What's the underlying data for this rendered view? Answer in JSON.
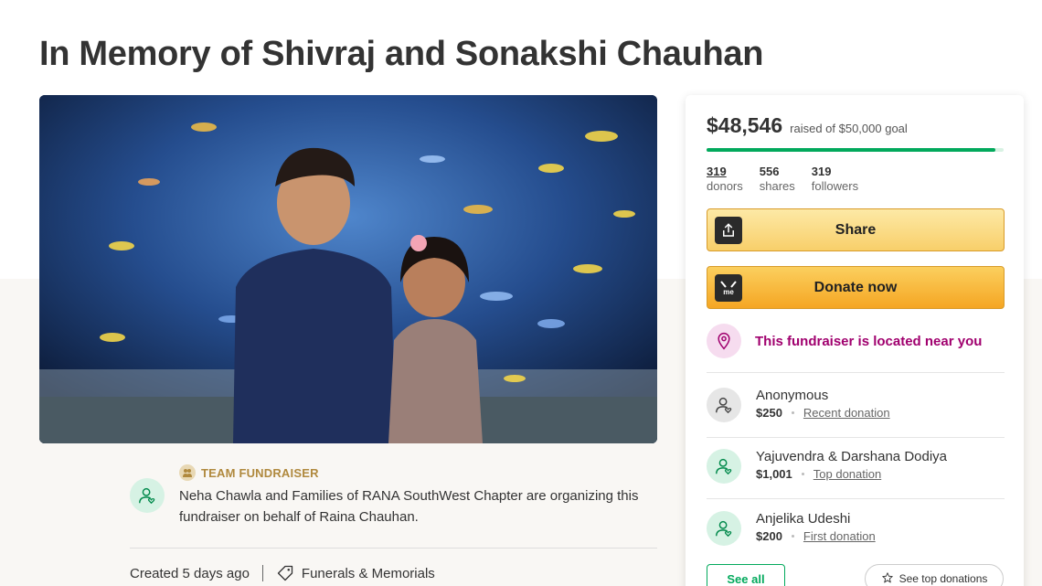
{
  "page": {
    "title": "In Memory of Shivraj and Sonakshi Chauhan"
  },
  "organizer": {
    "team_label": "TEAM FUNDRAISER",
    "text": "Neha Chawla and Families of RANA SouthWest Chapter are organizing this fundraiser on behalf of Raina Chauhan."
  },
  "meta": {
    "created": "Created 5 days ago",
    "category": "Funerals & Memorials"
  },
  "donation_card": {
    "amount": "$48,546",
    "goal_text": "raised of $50,000 goal",
    "progress_fraction": 0.971,
    "stats": [
      {
        "num": "319",
        "label": "donors"
      },
      {
        "num": "556",
        "label": "shares"
      },
      {
        "num": "319",
        "label": "followers"
      }
    ],
    "share_label": "Share",
    "donate_label": "Donate now",
    "near_text": "This fundraiser is located near you",
    "donors": [
      {
        "name": "Anonymous",
        "amount": "$250",
        "kind": "Recent donation"
      },
      {
        "name": "Yajuvendra & Darshana Dodiya",
        "amount": "$1,001",
        "kind": "Top donation"
      },
      {
        "name": "Anjelika Udeshi",
        "amount": "$200",
        "kind": "First donation"
      }
    ],
    "see_all_label": "See all",
    "see_top_label": "See top donations"
  },
  "colors": {
    "accent_green": "#02a95c",
    "near_magenta": "#a0006e",
    "team_gold": "#b0893e",
    "donate_orange": "#f5a623"
  }
}
